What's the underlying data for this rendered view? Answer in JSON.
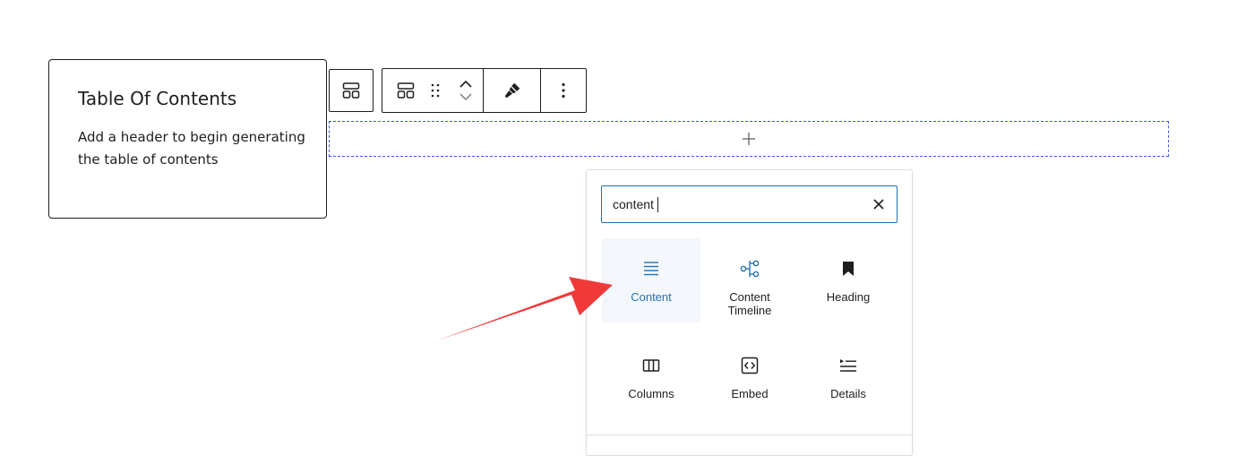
{
  "toc_block": {
    "title": "Table Of Contents",
    "description": "Add a header to begin generating the table of contents"
  },
  "toolbar": {
    "icons": [
      "block-variations-icon",
      "block-type-icon",
      "drag-handle-icon",
      "move-up-icon",
      "move-down-icon",
      "styles-brush-icon",
      "more-options-icon"
    ]
  },
  "appender": {
    "icon": "plus-icon"
  },
  "inserter": {
    "search": {
      "value": "content",
      "clear_icon": "close-icon"
    },
    "results": [
      {
        "label": "Content",
        "icon": "align-justify-icon",
        "selected": true
      },
      {
        "label": "Content Timeline",
        "icon": "timeline-icon",
        "selected": false
      },
      {
        "label": "Heading",
        "icon": "bookmark-icon",
        "selected": false
      },
      {
        "label": "Columns",
        "icon": "columns-icon",
        "selected": false
      },
      {
        "label": "Embed",
        "icon": "embed-icon",
        "selected": false
      },
      {
        "label": "Details",
        "icon": "details-icon",
        "selected": false
      }
    ]
  },
  "colors": {
    "accent": "#2271b1",
    "arrow": "#f03a3a",
    "appender_border": "#3858e9",
    "text": "#1e1e1e"
  }
}
